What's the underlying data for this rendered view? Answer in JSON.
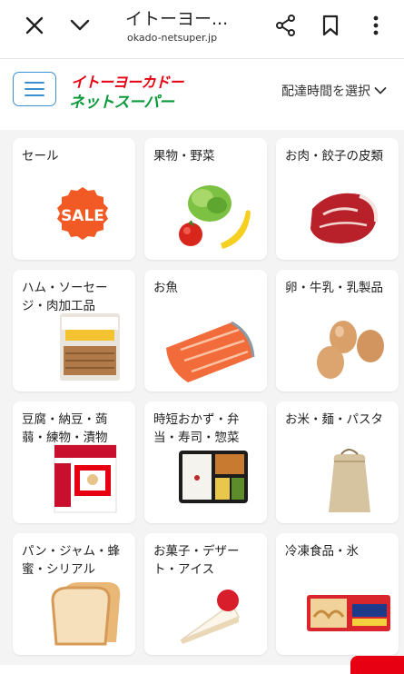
{
  "browser": {
    "title": "イトーヨー...",
    "url": "okado-netsuper.jp",
    "icons": [
      "close-icon",
      "chevron-down-icon",
      "share-icon",
      "bookmark-icon",
      "more-vertical-icon"
    ]
  },
  "header": {
    "logo_top": "イトーヨーカドー",
    "logo_bottom": "ネットスーパー",
    "delivery_label": "配達時間を選択",
    "menu_icon": "hamburger-icon"
  },
  "colors": {
    "accent_blue": "#3b8fd1",
    "brand_red": "#e60012",
    "brand_green": "#0a9a3a"
  },
  "categories": [
    {
      "label": "セール",
      "image": "sale-badge-image",
      "badge_text": "SALE"
    },
    {
      "label": "果物・野菜",
      "image": "fruits-vegetables-image"
    },
    {
      "label": "お肉・餃子の皮類",
      "image": "meat-image"
    },
    {
      "label": "ハム・ソーセージ・肉加工品",
      "image": "sausage-package-image"
    },
    {
      "label": "お魚",
      "image": "salmon-image"
    },
    {
      "label": "卵・牛乳・乳製品",
      "image": "eggs-image"
    },
    {
      "label": "豆腐・納豆・蒟蒻・練物・漬物",
      "image": "natto-package-image"
    },
    {
      "label": "時短おかず・弁当・寿司・惣菜",
      "image": "bento-image"
    },
    {
      "label": "お米・麺・パスタ",
      "image": "rice-bag-image"
    },
    {
      "label": "パン・ジャム・蜂蜜・シリアル",
      "image": "bread-image"
    },
    {
      "label": "お菓子・デザート・アイス",
      "image": "cake-image"
    },
    {
      "label": "冷凍食品・氷",
      "image": "gyoza-package-image"
    }
  ]
}
